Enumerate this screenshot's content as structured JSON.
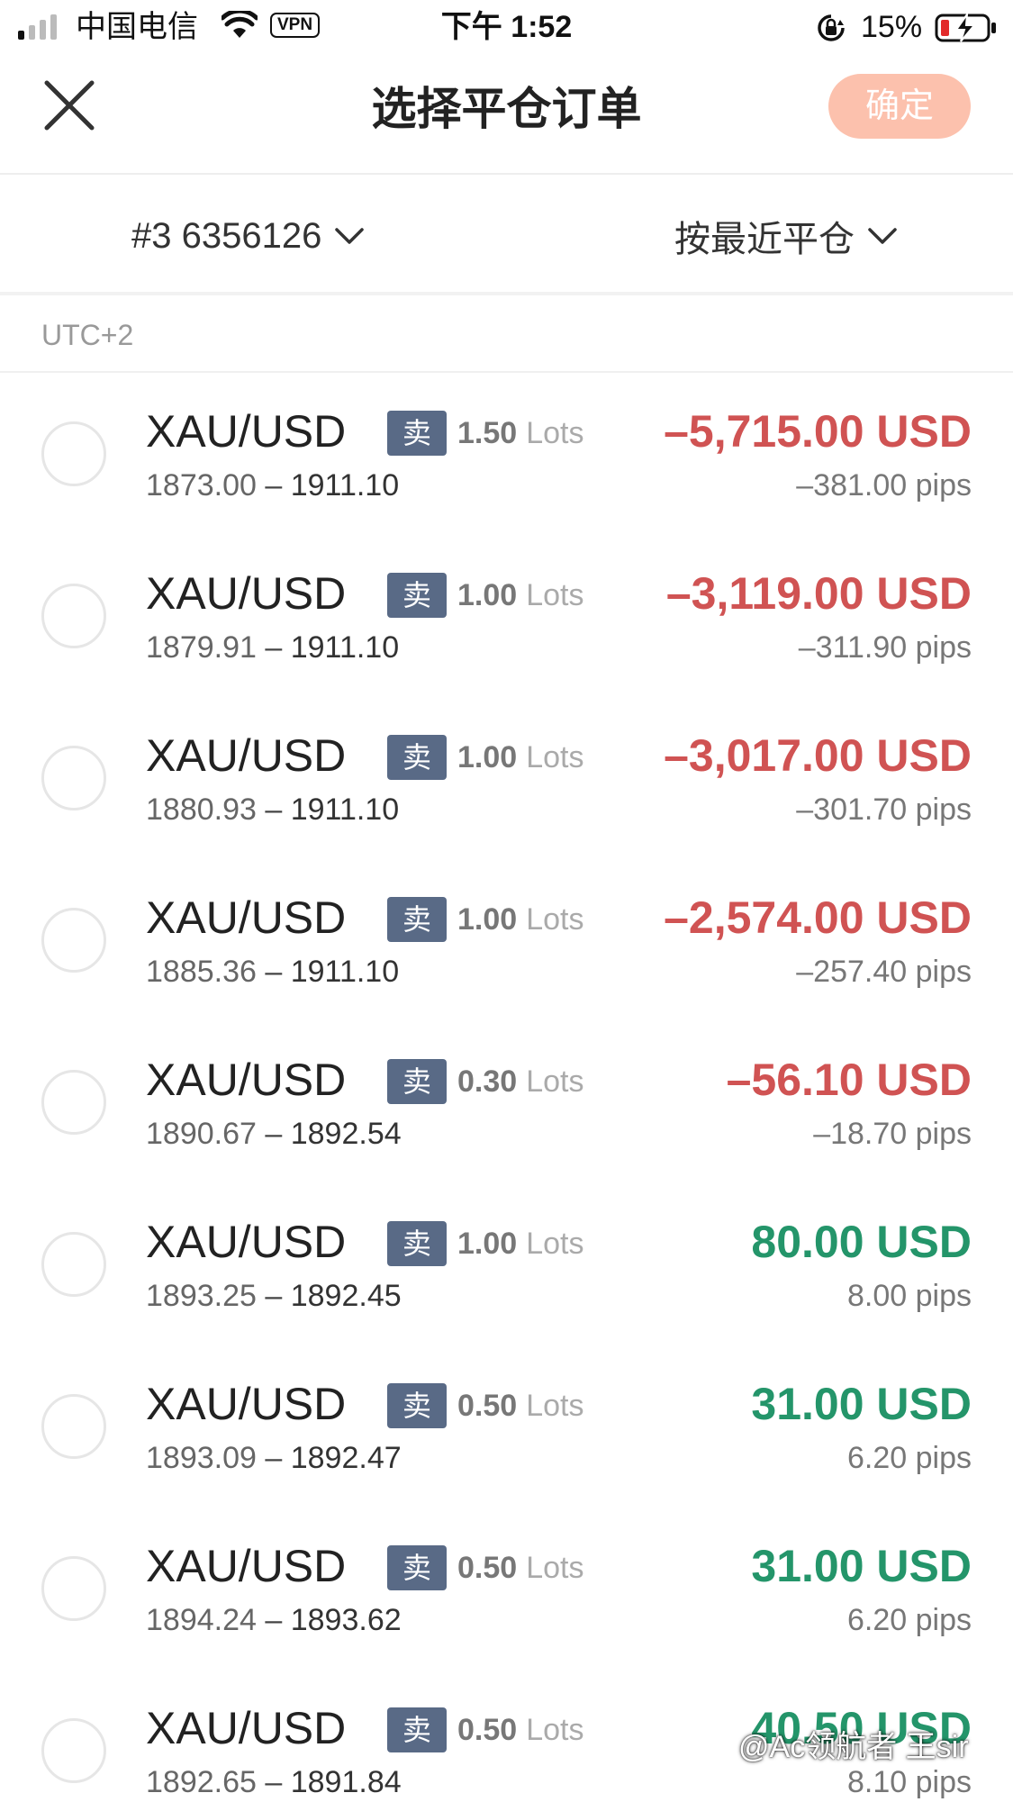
{
  "status_bar": {
    "carrier": "中国电信",
    "vpn": "VPN",
    "time": "下午 1:52",
    "battery": "15%"
  },
  "nav": {
    "title": "选择平仓订单",
    "confirm_label": "确定"
  },
  "filters": {
    "account": "#3 6356126",
    "sort": "按最近平仓"
  },
  "timezone": "UTC+2",
  "colors": {
    "loss": "#d05353",
    "profit": "#24956a",
    "badge": "#596a86",
    "confirm_button": "#fcc1ad"
  },
  "orders": [
    {
      "symbol": "XAU/USD",
      "side": "卖",
      "lots": "1.50",
      "lot_unit": "Lots",
      "open": "1873.00",
      "sep": "–",
      "close": "1911.10",
      "pl": "–5,715.00 USD",
      "pips": "–381.00 pips",
      "sign": "neg"
    },
    {
      "symbol": "XAU/USD",
      "side": "卖",
      "lots": "1.00",
      "lot_unit": "Lots",
      "open": "1879.91",
      "sep": "–",
      "close": "1911.10",
      "pl": "–3,119.00 USD",
      "pips": "–311.90 pips",
      "sign": "neg"
    },
    {
      "symbol": "XAU/USD",
      "side": "卖",
      "lots": "1.00",
      "lot_unit": "Lots",
      "open": "1880.93",
      "sep": "–",
      "close": "1911.10",
      "pl": "–3,017.00 USD",
      "pips": "–301.70 pips",
      "sign": "neg"
    },
    {
      "symbol": "XAU/USD",
      "side": "卖",
      "lots": "1.00",
      "lot_unit": "Lots",
      "open": "1885.36",
      "sep": "–",
      "close": "1911.10",
      "pl": "–2,574.00 USD",
      "pips": "–257.40 pips",
      "sign": "neg"
    },
    {
      "symbol": "XAU/USD",
      "side": "卖",
      "lots": "0.30",
      "lot_unit": "Lots",
      "open": "1890.67",
      "sep": "–",
      "close": "1892.54",
      "pl": "–56.10 USD",
      "pips": "–18.70 pips",
      "sign": "neg"
    },
    {
      "symbol": "XAU/USD",
      "side": "卖",
      "lots": "1.00",
      "lot_unit": "Lots",
      "open": "1893.25",
      "sep": "–",
      "close": "1892.45",
      "pl": "80.00 USD",
      "pips": "8.00 pips",
      "sign": "pos"
    },
    {
      "symbol": "XAU/USD",
      "side": "卖",
      "lots": "0.50",
      "lot_unit": "Lots",
      "open": "1893.09",
      "sep": "–",
      "close": "1892.47",
      "pl": "31.00 USD",
      "pips": "6.20 pips",
      "sign": "pos"
    },
    {
      "symbol": "XAU/USD",
      "side": "卖",
      "lots": "0.50",
      "lot_unit": "Lots",
      "open": "1894.24",
      "sep": "–",
      "close": "1893.62",
      "pl": "31.00 USD",
      "pips": "6.20 pips",
      "sign": "pos"
    },
    {
      "symbol": "XAU/USD",
      "side": "卖",
      "lots": "0.50",
      "lot_unit": "Lots",
      "open": "1892.65",
      "sep": "–",
      "close": "1891.84",
      "pl": "40.50 USD",
      "pips": "8.10 pips",
      "sign": "pos"
    }
  ],
  "watermark": "@Ac领航者 王sir"
}
